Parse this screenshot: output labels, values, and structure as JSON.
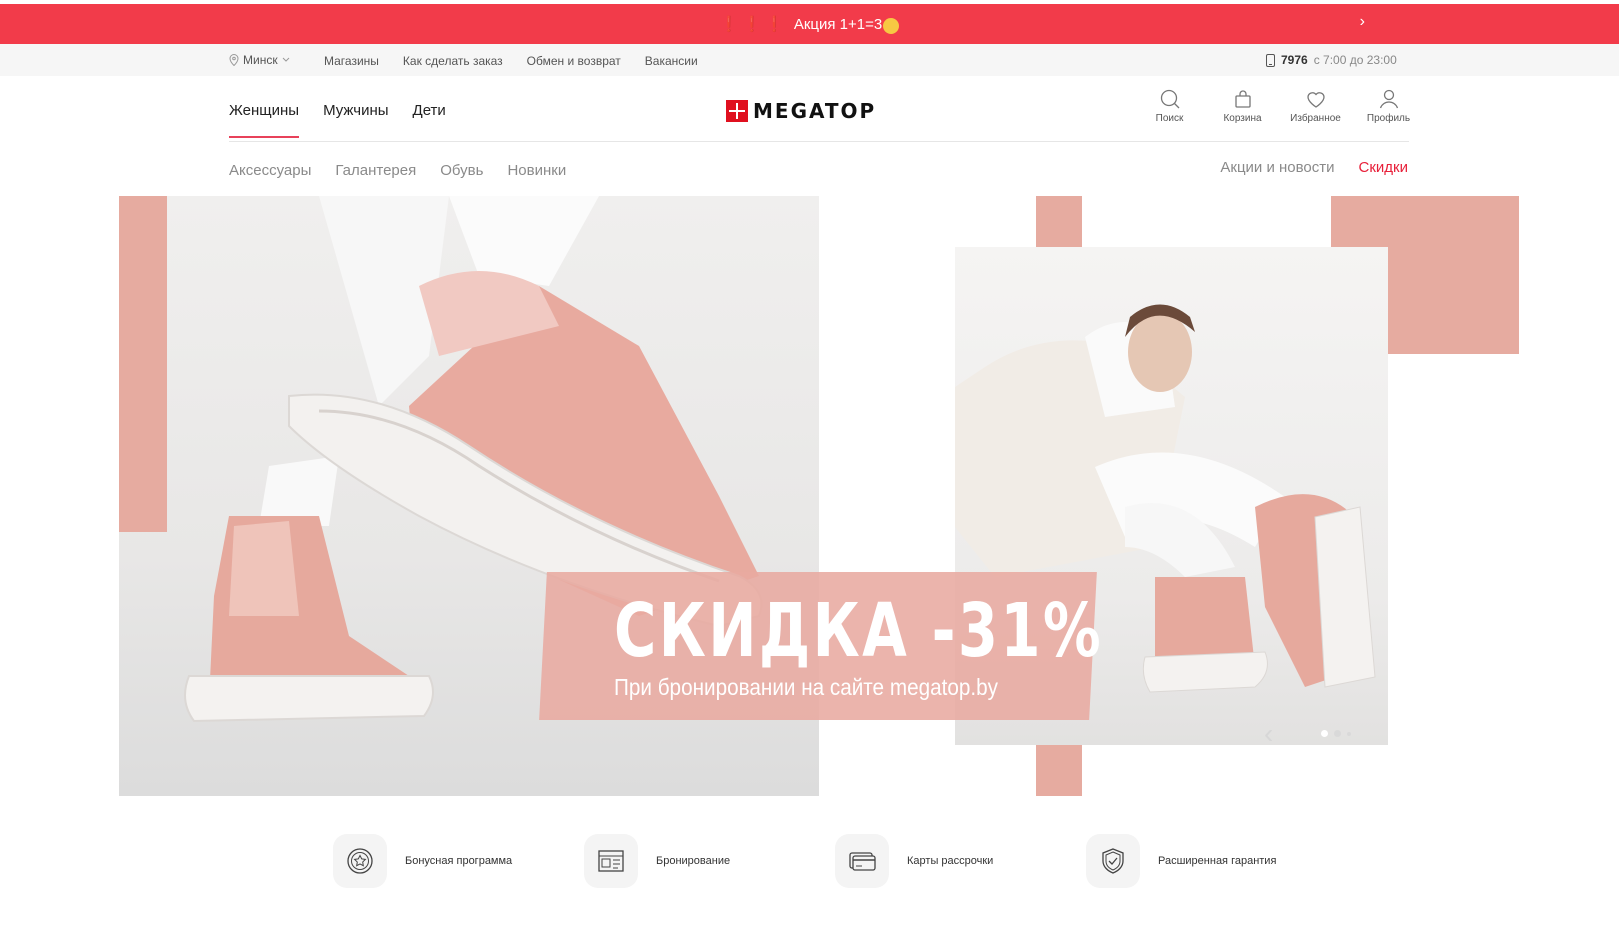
{
  "promo": {
    "marks": "❗❗❗",
    "text": "Акция 1+1=3"
  },
  "topbar": {
    "city": "Минск",
    "links": [
      "Магазины",
      "Как сделать заказ",
      "Обмен и возврат",
      "Вакансии"
    ],
    "phone": "7976",
    "hours": "с 7:00 до 23:00"
  },
  "header": {
    "gender_nav": [
      "Женщины",
      "Мужчины",
      "Дети"
    ],
    "logo_text": "MEGATOP",
    "icons": {
      "search": "Поиск",
      "cart": "Корзина",
      "favorites": "Избранное",
      "profile": "Профиль"
    }
  },
  "subnav": {
    "items": [
      "Аксессуары",
      "Галантерея",
      "Обувь",
      "Новинки"
    ],
    "news": "Акции и новости",
    "sale": "Скидки"
  },
  "hero": {
    "title": "СКИДКА -31%",
    "subtitle": "При бронировании на сайте megatop.by",
    "slides": 3,
    "active_slide": 1
  },
  "features": [
    {
      "label": "Бонусная программа",
      "icon": "star-badge-icon"
    },
    {
      "label": "Бронирование",
      "icon": "booking-icon"
    },
    {
      "label": "Карты рассрочки",
      "icon": "card-icon"
    },
    {
      "label": "Расширенная гарантия",
      "icon": "shield-icon"
    }
  ],
  "colors": {
    "accent": "#f23b4a",
    "sale": "#e8203a",
    "pink": "#e6aba0"
  }
}
